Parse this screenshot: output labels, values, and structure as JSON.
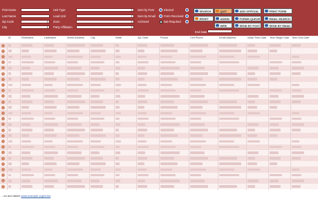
{
  "filters": {
    "col1": [
      "First Name",
      "Last Name",
      "Zip Code",
      "City"
    ],
    "col2": [
      "Unit Type",
      "Lead Unit",
      "Zone",
      "Party Affiliation"
    ],
    "col3": [
      "Sent by Post",
      "Sent by Email",
      "Archived"
    ],
    "col4": [
      "Elected",
      "Form Received",
      "Not Required"
    ],
    "end_date_label": "End Date:"
  },
  "buttons": {
    "search": "SEARCH",
    "quit": "QUIT",
    "add_official": "ADD OFFICIAL",
    "print_form": "PRINT FORM",
    "reset": "RESET",
    "admin": "ADMIN",
    "forms_queue": "FORMS QUEUE",
    "email_search": "EMAIL SEARCH",
    "web": "WEB",
    "send_by_post": "SEND BY POST",
    "send_by_email": "SEND BY EMAIL"
  },
  "table": {
    "headers": [
      "ID",
      "FirstName",
      "LastName",
      "Street Address",
      "City",
      "State",
      "Zip Code",
      "Phone",
      "Cell Phone",
      "Email Address",
      "Initial Term Date",
      "Term Begin Date",
      "Term End Date"
    ]
  },
  "footer": {
    "text": "...ed and tables",
    "link": "www.example.org/forms"
  }
}
